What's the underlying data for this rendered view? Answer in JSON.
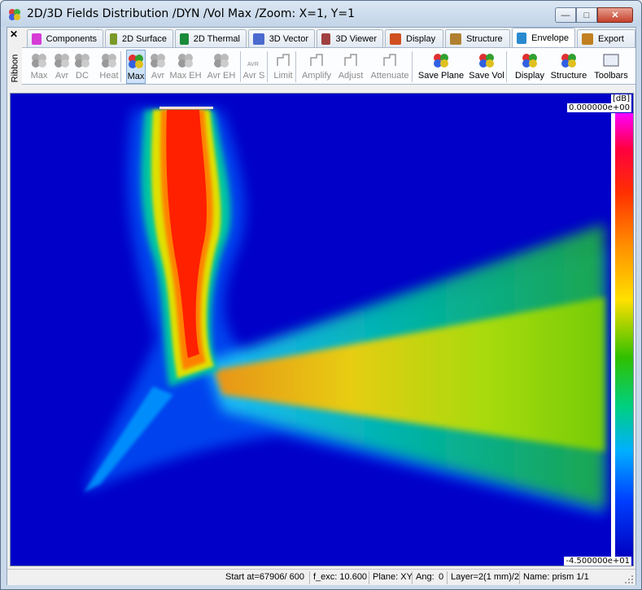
{
  "window": {
    "title": "2D/3D Fields Distribution /DYN /Vol Max /Zoom: X=1, Y=1",
    "minimize": "—",
    "maximize": "□",
    "close": "✕"
  },
  "ribbon": {
    "close": "✕",
    "label": "Ribbon"
  },
  "tabs": [
    {
      "label": "Components",
      "icon": "components-icon",
      "color": "#d63bd6"
    },
    {
      "label": "2D Surface",
      "icon": "2d-surface-icon",
      "color": "#7a9a2a"
    },
    {
      "label": "2D Thermal",
      "icon": "2d-thermal-icon",
      "color": "#1a8a3a"
    },
    {
      "label": "3D Vector",
      "icon": "3d-vector-icon",
      "color": "#4a6ad0"
    },
    {
      "label": "3D Viewer",
      "icon": "3d-viewer-icon",
      "color": "#a04040"
    },
    {
      "label": "Display",
      "icon": "display-icon",
      "color": "#d05020"
    },
    {
      "label": "Structure",
      "icon": "structure-icon",
      "color": "#b08030"
    },
    {
      "label": "Envelope",
      "icon": "envelope-icon",
      "color": "#2a8ad0"
    },
    {
      "label": "Export",
      "icon": "export-icon",
      "color": "#c08020"
    }
  ],
  "toolbar": [
    {
      "label": "Max",
      "icon": "max-dc-icon",
      "enabled": false
    },
    {
      "label": "Avr",
      "icon": "avr-dc-icon",
      "enabled": false
    },
    {
      "label": "DC",
      "icon": "dc-icon",
      "enabled": false
    },
    {
      "label": "Heat",
      "icon": "heat-icon",
      "enabled": false
    },
    {
      "label": "Max",
      "icon": "max-icon",
      "enabled": true,
      "selected": true
    },
    {
      "label": "Avr",
      "icon": "avr-icon",
      "enabled": false
    },
    {
      "label": "Max EH",
      "icon": "max-eh-icon",
      "enabled": false
    },
    {
      "label": "Avr EH",
      "icon": "avr-eh-icon",
      "enabled": false
    },
    {
      "label": "Avr S",
      "icon": "avr-s-icon",
      "enabled": false,
      "badge": "AVR"
    },
    {
      "label": "Limit",
      "icon": "limit-icon",
      "enabled": false
    },
    {
      "label": "Amplify",
      "icon": "amplify-icon",
      "enabled": false
    },
    {
      "label": "Adjust",
      "icon": "adjust-icon",
      "enabled": false
    },
    {
      "label": "Attenuate",
      "icon": "attenuate-icon",
      "enabled": false
    },
    {
      "label": "Save Plane",
      "icon": "save-plane-icon",
      "enabled": true
    },
    {
      "label": "Save Vol",
      "icon": "save-vol-icon",
      "enabled": true
    },
    {
      "label": "Display",
      "icon": "display-tool-icon",
      "enabled": true
    },
    {
      "label": "Structure",
      "icon": "structure-tool-icon",
      "enabled": true
    },
    {
      "label": "Toolbars",
      "icon": "toolbars-icon",
      "enabled": true
    }
  ],
  "colorbar": {
    "unit": "[dB]",
    "max_label": "0.000000e+00",
    "min_label": "-4.500000e+01",
    "max_db": 0,
    "min_db": -45
  },
  "status": {
    "start": "Start at=67906/ 600",
    "f_exc": "f_exc: 10.600",
    "plane": "Plane: XY",
    "ang": "Ang:",
    "ang_value": "0",
    "layer": "Layer=2(1 mm)/2",
    "name": "Name: prism 1/1"
  }
}
